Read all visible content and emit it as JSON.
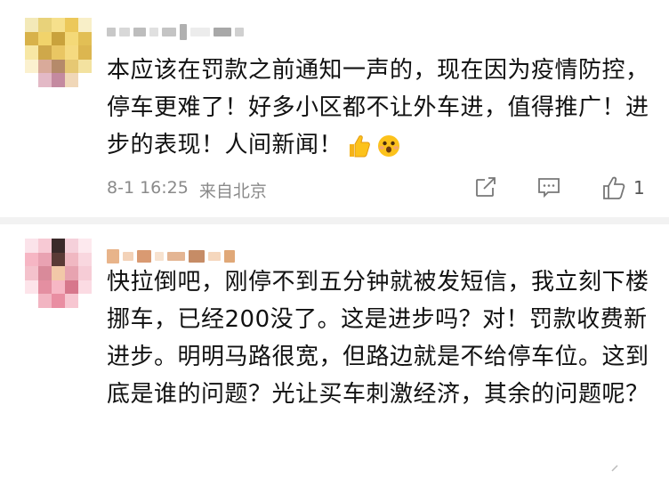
{
  "comments": [
    {
      "username": "",
      "text": "本应该在罚款之前通知一声的，现在因为疫情防控，停车更难了！好多小区都不让外车进，值得推广！进步的表现！人间新闻！",
      "emoji_icons": [
        "thumbs-up-icon",
        "hushed-face-icon"
      ],
      "timestamp": "8-1 16:25",
      "location": "来自北京",
      "like_count": "1",
      "actions": [
        "share-icon",
        "comment-icon",
        "like-icon"
      ]
    },
    {
      "username": "",
      "text": "快拉倒吧，刚停不到五分钟就被发短信，我立刻下楼挪车，已经200没了。这是进步吗？对！罚款收费新进步。明明马路很宽，但路边就是不给停车位。这到底是谁的问题？光让买车刺激经济，其余的问题呢？"
    }
  ],
  "colors": {
    "text": "#111111",
    "meta": "#8a8a8a",
    "icon": "#777777",
    "divider": "#f2f2f2"
  }
}
